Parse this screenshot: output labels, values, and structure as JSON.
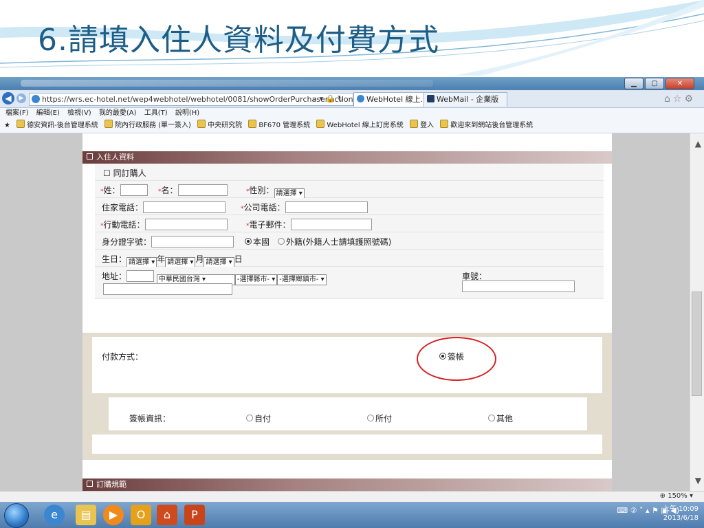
{
  "slide": {
    "title": "6.請填入住人資料及付費方式"
  },
  "browser": {
    "url": "https://wrs.ec-hotel.net/wep4webhotel/webhotel/0081/showOrderPurchaser.action",
    "url_tools": "⌕ ▾ 🔒 ↻",
    "tabs": [
      {
        "label": "WebHotel 線上...",
        "close": "×",
        "icon": "ie-icon"
      },
      {
        "label": "WebMail - 企業版",
        "icon": "mail-icon"
      }
    ],
    "menu": [
      "檔案(F)",
      "編輯(E)",
      "檢視(V)",
      "我的最愛(A)",
      "工具(T)",
      "說明(H)"
    ],
    "favorites": [
      "德安資訊-後台管理系統",
      "院內行政服務 (單一簽入)",
      "中央研究院",
      "BF670 管理系統",
      "WebHotel 線上訂房系統",
      "登入",
      "歡迎來到網站後台管理系統"
    ],
    "zoom": "150%"
  },
  "form": {
    "section_guest": "入住人資料",
    "same_as_buyer": "同訂購人",
    "last_name": "姓：",
    "first_name": "名：",
    "gender": "性別：",
    "gender_select": "請選擇",
    "home_phone": "住家電話：",
    "office_phone": "公司電話：",
    "mobile": "行動電話：",
    "email": "電子郵件：",
    "id_no": "身分證字號：",
    "native": "本國",
    "foreign": "外籍(外籍人士請填護照號碼)",
    "birthday": "生日：",
    "year_select": "請選擇",
    "year": "年",
    "month_select": "請選擇",
    "month": "月",
    "day_select": "請選擇",
    "day": "日",
    "address": "地址：",
    "country_select": "中華民國台灣",
    "county_select": "-選擇縣市-",
    "town_select": "-選擇鄉鎮市-",
    "plate": "車號：",
    "payment_label": "付款方式：",
    "payment_option": "簽帳",
    "account_label": "簽帳資訊：",
    "account_options": [
      "自付",
      "所付",
      "其他"
    ],
    "section_rules": "訂購規範"
  },
  "taskbar": {
    "tray": "⌨ ② ˚ ▴ ⚑ ▣ ◀)",
    "time": "上午 10:09",
    "date": "2013/6/18"
  }
}
